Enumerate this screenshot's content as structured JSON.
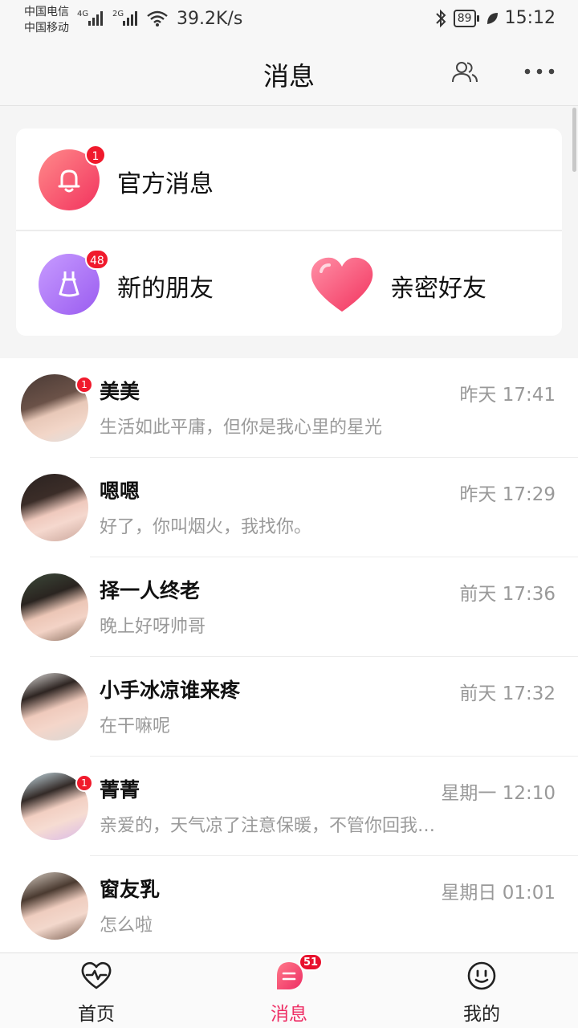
{
  "status_bar": {
    "carrier_1": "中国电信",
    "carrier_2": "中国移动",
    "sig_1": "4G",
    "sig_2": "2G",
    "net_speed": "39.2K/s",
    "battery": "89",
    "time": "15:12"
  },
  "header": {
    "title": "消息",
    "contacts_icon": "contacts-icon",
    "more_icon": "more-icon"
  },
  "top_card": {
    "official": {
      "label": "官方消息",
      "badge": "1",
      "icon": "bell-icon"
    },
    "new_friends": {
      "label": "新的朋友",
      "badge": "48",
      "icon": "dress-icon"
    },
    "close_friends": {
      "label": "亲密好友",
      "icon": "heart-icon"
    }
  },
  "messages": [
    {
      "name": "美美",
      "time": "昨天 17:41",
      "preview": "生活如此平庸，但你是我心里的星光",
      "badge": "1"
    },
    {
      "name": "嗯嗯",
      "time": "昨天 17:29",
      "preview": "好了，你叫烟火，我找你。",
      "badge": ""
    },
    {
      "name": "择一人终老",
      "time": "前天 17:36",
      "preview": "晚上好呀帅哥",
      "badge": ""
    },
    {
      "name": "小手冰凉谁来疼",
      "time": "前天 17:32",
      "preview": "在干嘛呢",
      "badge": ""
    },
    {
      "name": "菁菁",
      "time": "星期一 12:10",
      "preview": "亲爱的，天气凉了注意保暖，不管你回我…",
      "badge": "1"
    },
    {
      "name": "窗友乳",
      "time": "星期日 01:01",
      "preview": "怎么啦",
      "badge": ""
    }
  ],
  "bottom_nav": {
    "home": "首页",
    "messages": "消息",
    "messages_badge": "51",
    "mine": "我的"
  },
  "colors": {
    "accent": "#ee2d64",
    "badge": "#f01a2c",
    "bell_gradient_start": "#ff8a8a",
    "bell_gradient_end": "#f2335e",
    "dress_gradient_start": "#c79bff",
    "dress_gradient_end": "#9a5cf0"
  }
}
